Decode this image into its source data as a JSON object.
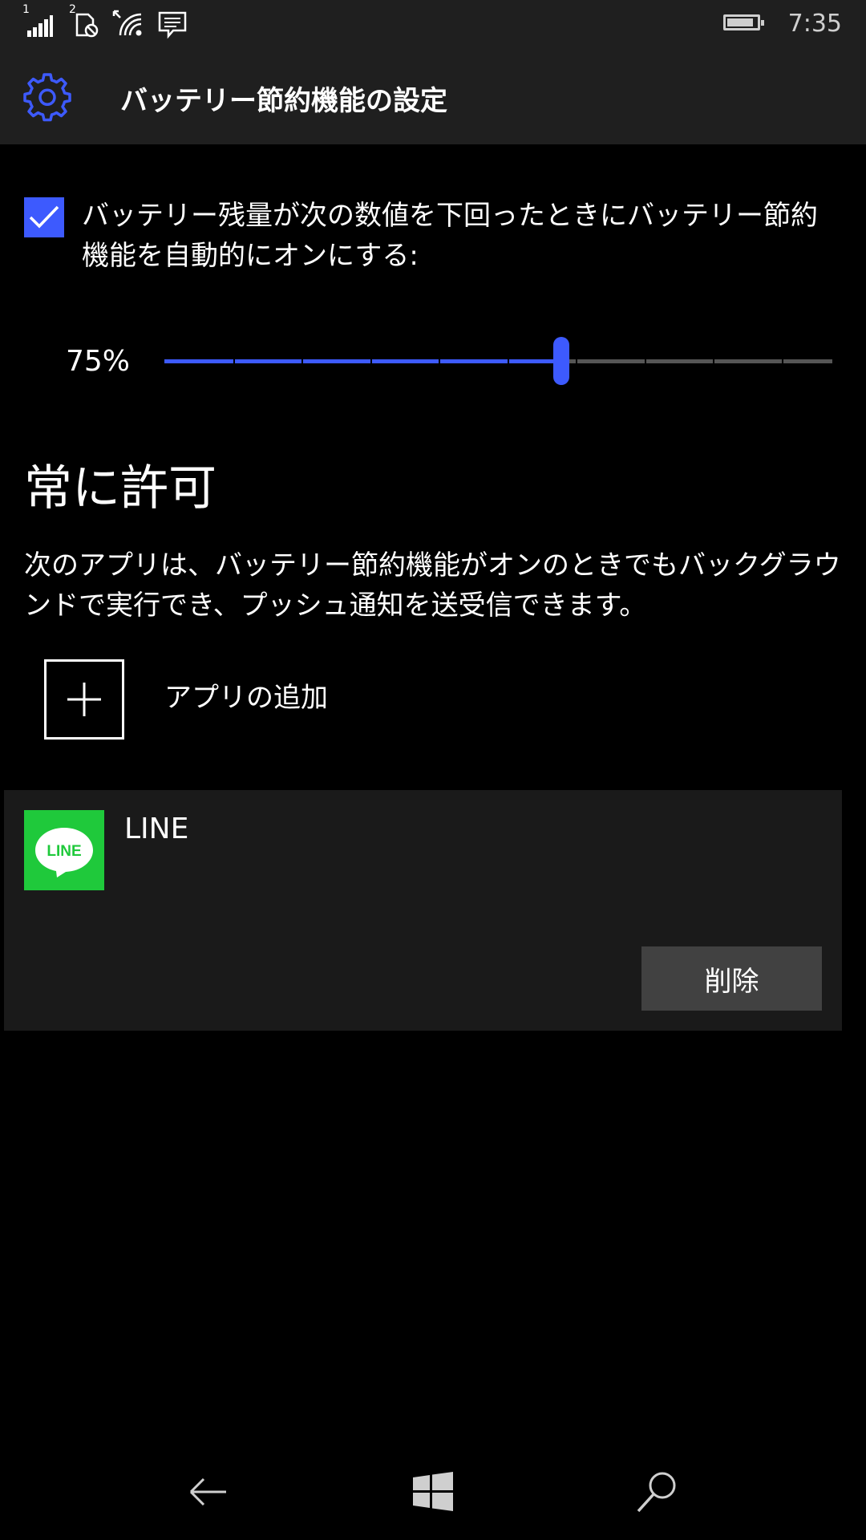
{
  "status_bar": {
    "sim1_label": "1",
    "sim2_label": "2",
    "time": "7:35",
    "battery_level": 0.9,
    "icons": [
      "signal-icon",
      "sim-icon",
      "wifi-icon",
      "message-icon",
      "battery-icon"
    ]
  },
  "header": {
    "icon": "gear-icon",
    "title": "バッテリー節約機能の設定"
  },
  "auto_saver": {
    "checked": true,
    "label": "バッテリー残量が次の数値を下回ったときにバッテリー節約機能を自動的にオンにする:",
    "slider_value": 75,
    "slider_value_text": "75%"
  },
  "always_allowed": {
    "heading": "常に許可",
    "description": "次のアプリは、バッテリー節約機能がオンのときでもバックグラウンドで実行でき、プッシュ通知を送受信できます。",
    "add_app_label": "アプリの追加"
  },
  "apps": [
    {
      "name": "LINE",
      "icon_text": "LINE",
      "remove_label": "削除"
    }
  ],
  "colors": {
    "accent": "#3d5afe",
    "line_green": "#1fc93b",
    "chrome_bg": "#1f1f1f",
    "card_bg": "#1a1a1a",
    "button_bg": "#414141"
  },
  "nav_bar": {
    "icons": [
      "back-icon",
      "windows-start-icon",
      "search-icon"
    ]
  }
}
